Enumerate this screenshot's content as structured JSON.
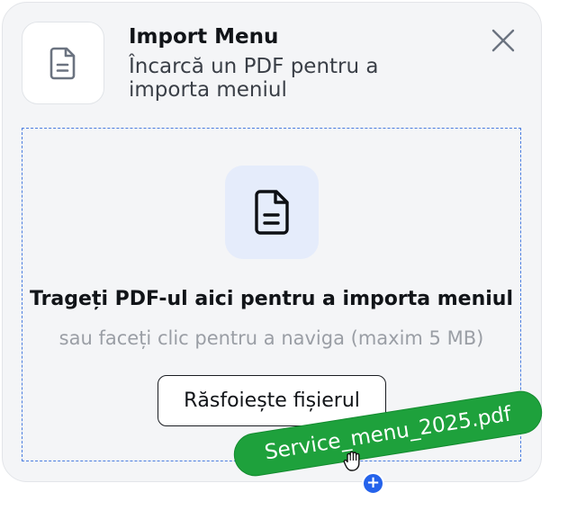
{
  "dialog": {
    "title": "Import Menu",
    "subtitle": "Încarcă un PDF pentru a importa meniul",
    "header_icon": "file-text-icon",
    "close_icon": "close-icon"
  },
  "dropzone": {
    "icon": "file-text-icon",
    "heading": "Trageți PDF-ul aici pentru a importa meniul",
    "hint": "sau faceți clic pentru a naviga (maxim 5 MB)",
    "browse_label": "Răsfoiește fișierul"
  },
  "drag_preview": {
    "filename": "Service_menu_2025.pdf",
    "cursor_icon": "grab-hand-cursor-icon",
    "badge_icon": "plus-icon",
    "badge_symbol": "+"
  },
  "colors": {
    "accent": "#2563eb",
    "dropzone_border": "#4a7de0",
    "drag_chip": "#1ea13c",
    "icon_tile_bg": "#e5ecfb"
  }
}
